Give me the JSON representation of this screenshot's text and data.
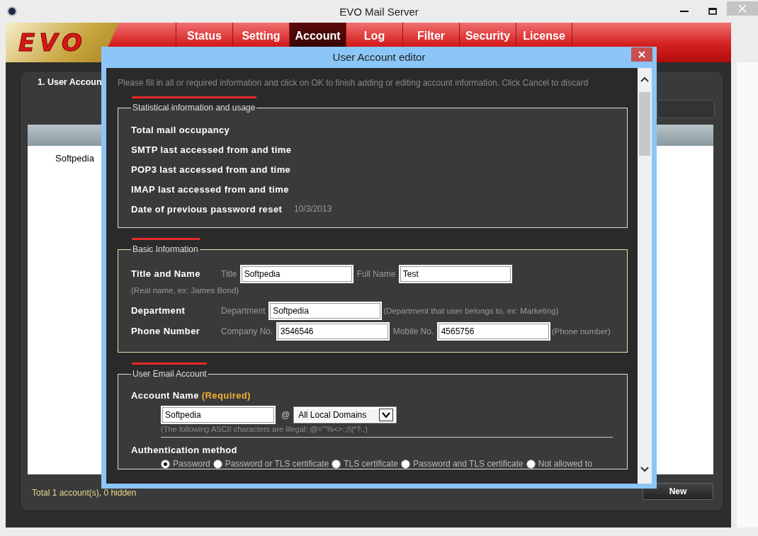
{
  "window": {
    "title": "EVO Mail Server"
  },
  "logo": {
    "text": "EVO"
  },
  "tabs": [
    {
      "label": "Status",
      "selected": false
    },
    {
      "label": "Setting",
      "selected": false
    },
    {
      "label": "Account",
      "selected": true
    },
    {
      "label": "Log",
      "selected": false
    },
    {
      "label": "Filter",
      "selected": false
    },
    {
      "label": "Security",
      "selected": false
    },
    {
      "label": "License",
      "selected": false
    }
  ],
  "panel": {
    "title": "1. User Accoun",
    "accounts": [
      {
        "name": "Softpedia",
        "selected": false
      }
    ],
    "summary": "Total 1 account(s), 0 hidden",
    "new_button": "New"
  },
  "dialog": {
    "title": "User Account editor",
    "intro": "Please fill in all or required information and click on OK to finish adding or editing account information. Click Cancel to discard",
    "statistics": {
      "legend": "Statistical information and usage",
      "rows": [
        {
          "label": "Total mail occupancy"
        },
        {
          "label": "SMTP last accessed from and time"
        },
        {
          "label": "POP3 last accessed from and time"
        },
        {
          "label": "IMAP last accessed from and time"
        },
        {
          "label": "Date of previous password reset",
          "value": "10/3/2013"
        }
      ]
    },
    "basic": {
      "legend": "Basic Information",
      "rows": [
        {
          "label": "Title and Name",
          "items": [
            {
              "kind": "caption",
              "text": "Title"
            },
            {
              "kind": "field",
              "value": "Softpedia"
            },
            {
              "kind": "caption",
              "text": "Full Name"
            },
            {
              "kind": "field",
              "value": "Test"
            },
            {
              "kind": "hint",
              "text": "(Real name, ex: James Bond)"
            }
          ]
        },
        {
          "label": "Department",
          "items": [
            {
              "kind": "caption",
              "text": "Department"
            },
            {
              "kind": "field",
              "value": "Softpedia"
            },
            {
              "kind": "hint",
              "text": "(Department that user belongs to, ex: Marketing)"
            }
          ]
        },
        {
          "label": "Phone Number",
          "items": [
            {
              "kind": "caption",
              "text": "Company No."
            },
            {
              "kind": "field",
              "value": "3546546"
            },
            {
              "kind": "caption",
              "text": "Mobile No."
            },
            {
              "kind": "field",
              "value": "4565756"
            },
            {
              "kind": "hint",
              "text": "(Phone number)"
            }
          ]
        }
      ]
    },
    "email": {
      "legend": "User Email Account",
      "account_label": "Account Name",
      "required": "(Required)",
      "account_value": "Softpedia",
      "at": "@",
      "domain": "All Local Domains",
      "illegal_hint": "(The following ASCII characters are illegal: @=\"'%<>:;/\\|*?..)",
      "auth_label": "Authentication method",
      "auth_options": [
        {
          "label": "Password",
          "selected": true
        },
        {
          "label": "Password or TLS certificate",
          "selected": false
        },
        {
          "label": "TLS certificate",
          "selected": false
        },
        {
          "label": "Password and TLS certificate",
          "selected": false
        },
        {
          "label": "Not allowed to",
          "selected": false
        }
      ]
    }
  }
}
